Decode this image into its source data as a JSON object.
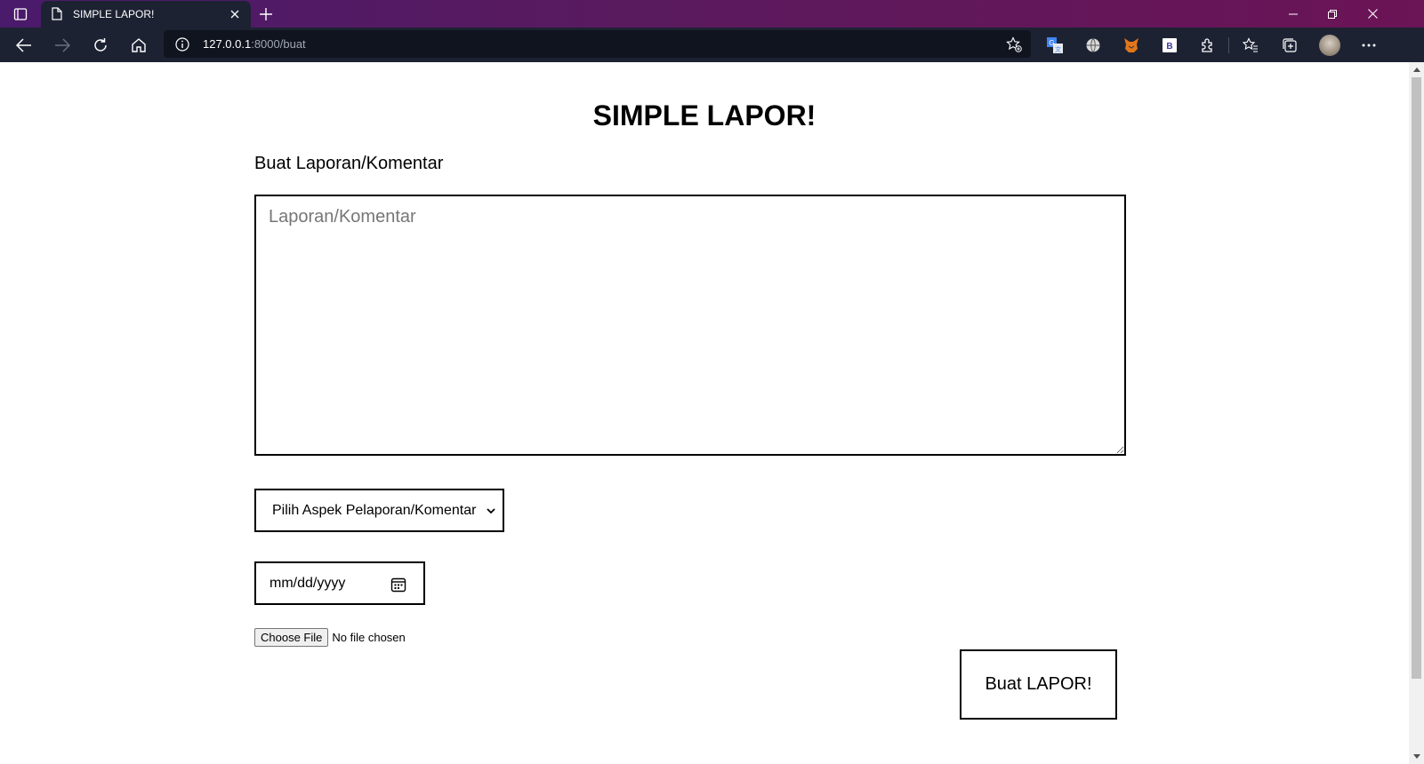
{
  "browser": {
    "tab": {
      "title": "SIMPLE LAPOR!"
    },
    "address": {
      "host": "127.0.0.1",
      "path": ":8000/buat"
    },
    "colors": {
      "titlebar": "#5a1a5e",
      "toolbar": "#1d2233"
    }
  },
  "page": {
    "title": "SIMPLE LAPOR!",
    "subtitle": "Buat Laporan/Komentar",
    "textarea": {
      "placeholder": "Laporan/Komentar",
      "value": ""
    },
    "aspect_select": {
      "selected": "Pilih Aspek Pelaporan/Komentar"
    },
    "date_input": {
      "value": "mm/dd/yyyy"
    },
    "file_input": {
      "button_label": "Choose File",
      "status": "No file chosen"
    },
    "submit_label": "Buat LAPOR!"
  }
}
